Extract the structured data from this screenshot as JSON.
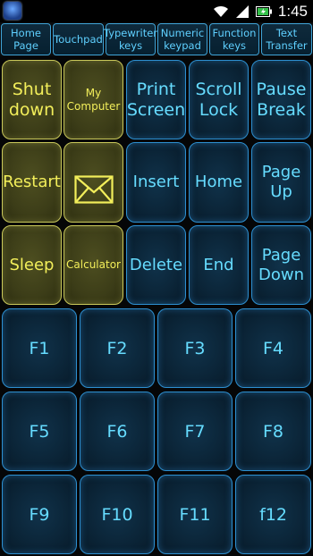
{
  "status_bar": {
    "time": "1:45",
    "icons": [
      "app-icon",
      "wifi-icon",
      "signal-icon",
      "battery-icon"
    ]
  },
  "tabs": [
    "Home\nPage",
    "Touchpad",
    "Typewriter\nkeys",
    "Numeric\nkeypad",
    "Function\nkeys",
    "Text\nTransfer"
  ],
  "keys": {
    "shutdown": "Shut\ndown",
    "my_computer": "My\nComputer",
    "print_screen": "Print\nScreen",
    "scroll_lock": "Scroll\nLock",
    "pause_break": "Pause\nBreak",
    "restart": "Restart",
    "mail_icon": "envelope-icon",
    "insert": "Insert",
    "home": "Home",
    "page_up": "Page\nUp",
    "sleep": "Sleep",
    "calculator": "Calculator",
    "delete": "Delete",
    "end": "End",
    "page_down": "Page\nDown",
    "f1": "F1",
    "f2": "F2",
    "f3": "F3",
    "f4": "F4",
    "f5": "F5",
    "f6": "F6",
    "f7": "F7",
    "f8": "F8",
    "f9": "F9",
    "f10": "F10",
    "f11": "F11",
    "f12": "f12"
  },
  "colors": {
    "blue_text": "#66dcff",
    "yellow_text": "#f2ee5a",
    "blue_border": "#2d8fd0",
    "yellow_border": "#c9c85a"
  }
}
